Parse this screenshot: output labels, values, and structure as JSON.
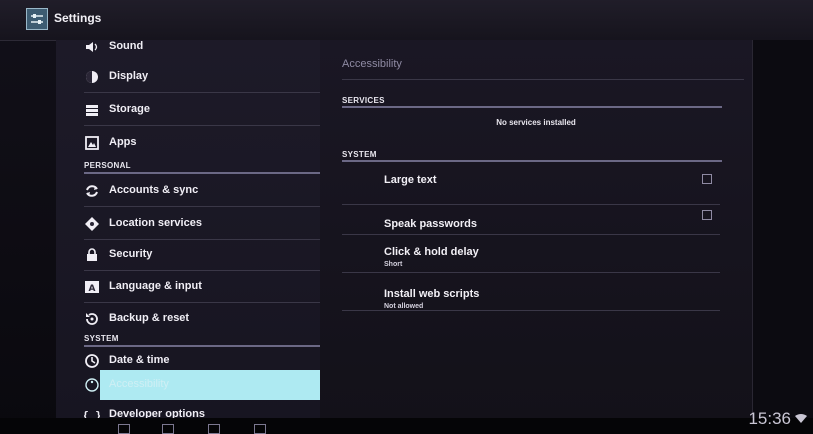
{
  "window": {
    "title": "Settings"
  },
  "sidebar": {
    "items": [
      {
        "label": "Sound",
        "icon": "speaker-icon"
      },
      {
        "label": "Display",
        "icon": "display-icon"
      },
      {
        "label": "Storage",
        "icon": "storage-icon"
      },
      {
        "label": "Apps",
        "icon": "apps-icon"
      },
      {
        "label": "Accounts & sync",
        "icon": "sync-icon"
      },
      {
        "label": "Location services",
        "icon": "location-icon"
      },
      {
        "label": "Security",
        "icon": "lock-icon"
      },
      {
        "label": "Language & input",
        "icon": "keyboard-icon"
      },
      {
        "label": "Backup & reset",
        "icon": "backup-icon"
      },
      {
        "label": "Date & time",
        "icon": "clock-icon"
      },
      {
        "label": "Accessibility",
        "icon": "accessibility-icon"
      },
      {
        "label": "Developer options",
        "icon": "braces-icon"
      }
    ],
    "sections": {
      "personal": "PERSONAL",
      "system": "SYSTEM"
    },
    "selected": "Accessibility"
  },
  "content": {
    "title": "Accessibility",
    "services_header": "SERVICES",
    "no_services": "No services installed",
    "system_header": "SYSTEM",
    "rows": [
      {
        "label": "Large text",
        "checked": false
      },
      {
        "label": "Speak passwords",
        "checked": false
      },
      {
        "label": "Click & hold delay",
        "summary": "Short"
      },
      {
        "label": "Install web scripts",
        "summary": "Not allowed"
      }
    ]
  },
  "status": {
    "time": "15:36"
  },
  "colors": {
    "selected_bg": "#aeeaf2",
    "section_line": "#6b6885",
    "background": "#1a1724"
  }
}
